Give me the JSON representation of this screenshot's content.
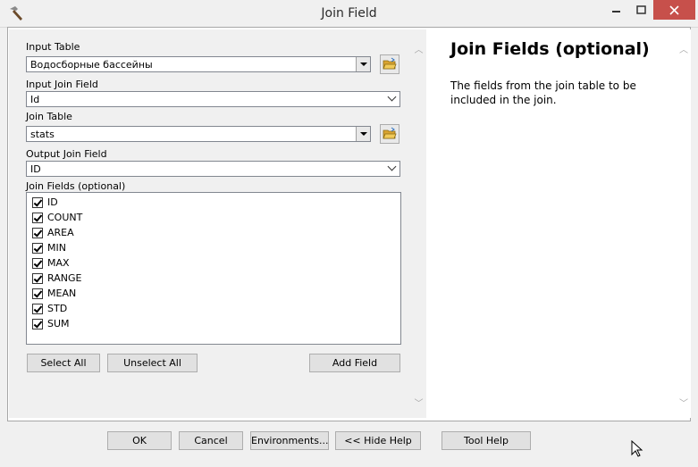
{
  "window": {
    "title": "Join Field"
  },
  "form": {
    "input_table": {
      "label": "Input Table",
      "value": "Водосборные бассейны"
    },
    "input_join_field": {
      "label": "Input Join Field",
      "value": "Id"
    },
    "join_table": {
      "label": "Join Table",
      "value": "stats"
    },
    "output_join_field": {
      "label": "Output Join Field",
      "value": "ID"
    },
    "join_fields": {
      "label": "Join Fields (optional)",
      "items": [
        {
          "label": "ID",
          "checked": true
        },
        {
          "label": "COUNT",
          "checked": true
        },
        {
          "label": "AREA",
          "checked": true
        },
        {
          "label": "MIN",
          "checked": true
        },
        {
          "label": "MAX",
          "checked": true
        },
        {
          "label": "RANGE",
          "checked": true
        },
        {
          "label": "MEAN",
          "checked": true
        },
        {
          "label": "STD",
          "checked": true
        },
        {
          "label": "SUM",
          "checked": true
        }
      ]
    },
    "buttons": {
      "select_all": "Select All",
      "unselect_all": "Unselect All",
      "add_field": "Add Field"
    }
  },
  "help": {
    "title": "Join Fields (optional)",
    "text": "The fields from the join table to be included in the join."
  },
  "footer": {
    "ok": "OK",
    "cancel": "Cancel",
    "environments": "Environments...",
    "hide_help": "<< Hide Help",
    "tool_help": "Tool Help"
  },
  "icons": {
    "app": "hammer-icon",
    "folder": "open-folder-icon",
    "cursor": "mouse-pointer-icon"
  },
  "colors": {
    "close_button": "#c7504b",
    "folder_yellow": "#e8b73c"
  }
}
